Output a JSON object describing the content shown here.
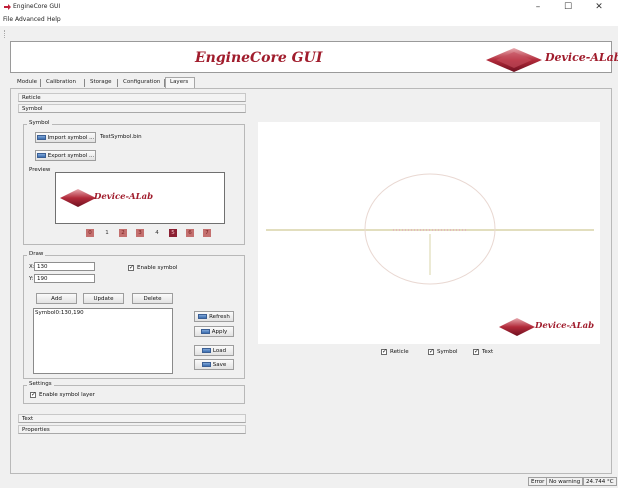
{
  "window": {
    "title": "EngineCore GUI",
    "minimize_glyph": "–",
    "maximize_glyph": "☐",
    "close_glyph": "✕",
    "app_icon": "red-arrow-icon"
  },
  "menu": {
    "file": "File",
    "advanced": "Advanced",
    "help": "Help"
  },
  "banner": {
    "title": "EngineCore GUI",
    "logo_text": "Device-ALab",
    "logo_icon": "device-alab-diamond-logo"
  },
  "tabs": [
    {
      "label": "Module"
    },
    {
      "label": "Calibration"
    },
    {
      "label": "Storage"
    },
    {
      "label": "Configuration"
    },
    {
      "label": "Layers"
    }
  ],
  "active_tab": "Layers",
  "sections": {
    "reticle": "Reticle",
    "symbol": "Symbol",
    "text": "Text",
    "properties": "Properties"
  },
  "symbol_group": {
    "title": "Symbol",
    "import_button": "Import symbol ...",
    "filename": "TestSymbol.bin",
    "export_button": "Export symbol ...",
    "preview_label": "Preview",
    "preview_logo_text": "Device-ALab",
    "slots": [
      "0",
      "1",
      "2",
      "3",
      "4",
      "5",
      "6",
      "7"
    ],
    "selected_slot": "5"
  },
  "draw_group": {
    "title": "Draw",
    "x_label": "X:",
    "x_value": "130",
    "y_label": "Y:",
    "y_value": "190",
    "enable_symbol_label": "Enable symbol",
    "enable_symbol_checked": true,
    "add_button": "Add",
    "update_button": "Update",
    "delete_button": "Delete",
    "list_items": [
      "Symbol0:130,190"
    ],
    "refresh_button": "Refresh",
    "apply_button": "Apply",
    "load_button": "Load",
    "save_button": "Save"
  },
  "settings_group": {
    "title": "Settings",
    "enable_layer_label": "Enable symbol layer",
    "enable_layer_checked": true
  },
  "canvas": {
    "logo_text": "Device-ALab",
    "reticle_checkbox": "Reticle",
    "symbol_checkbox": "Symbol",
    "text_checkbox": "Text"
  },
  "status": {
    "error": "Error",
    "warning": "No warning",
    "temperature": "24.744 °C"
  },
  "colors": {
    "brand": "#a01c2c",
    "slot_filled": "#c4706f",
    "slot_selected": "#8b1f32",
    "reticle_line": "#d9d4a8",
    "reticle_ticks": "#e6b8c0"
  }
}
